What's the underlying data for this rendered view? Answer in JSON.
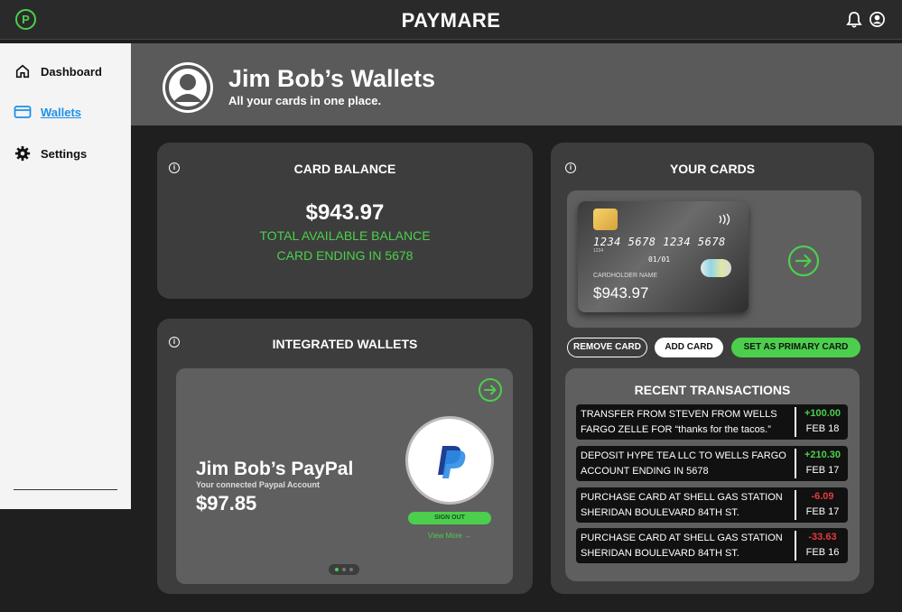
{
  "app": {
    "title": "PAYMARE",
    "logo_letter": "P",
    "accent": "#4ccf4c"
  },
  "sidebar": {
    "items": [
      {
        "label": "Dashboard",
        "icon": "home-icon"
      },
      {
        "label": "Wallets",
        "icon": "card-icon",
        "active": true
      },
      {
        "label": "Settings",
        "icon": "gear-icon"
      }
    ]
  },
  "header": {
    "title": "Jim Bob’s Wallets",
    "subtitle": "All your cards in one place."
  },
  "balance": {
    "title": "CARD BALANCE",
    "amount": "$943.97",
    "line1": "TOTAL AVAILABLE BALANCE",
    "line2": "CARD ENDING IN 5678"
  },
  "wallets": {
    "title": "INTEGRATED WALLETS",
    "name": "Jim Bob’s PayPal",
    "subtitle": "Your connected Paypal Account",
    "amount": "$97.85",
    "signout": "SIGN OUT",
    "view_more": "View More",
    "slides_total": 3,
    "slide_active": 1
  },
  "cards": {
    "title": "YOUR CARDS",
    "card": {
      "number": "1234 5678 1234 5678",
      "small_number": "1234",
      "expiry": "01/01",
      "holder_label": "CARDHOLDER NAME",
      "balance": "$943.97"
    },
    "buttons": {
      "remove": "REMOVE CARD",
      "add": "ADD CARD",
      "primary": "SET AS PRIMARY CARD"
    }
  },
  "transactions": {
    "title": "RECENT TRANSACTIONS",
    "items": [
      {
        "desc": "TRANSFER FROM STEVEN FROM WELLS FARGO ZELLE FOR “thanks for the tacos.”",
        "amount": "+100.00",
        "date": "FEB 18",
        "type": "pos"
      },
      {
        "desc": "DEPOSIT HYPE TEA LLC TO WELLS FARGO ACCOUNT ENDING IN 5678",
        "amount": "+210.30",
        "date": "FEB 17",
        "type": "pos"
      },
      {
        "desc": "PURCHASE CARD AT SHELL GAS STATION SHERIDAN BOULEVARD 84TH ST.",
        "amount": "-6.09",
        "date": "FEB 17",
        "type": "neg"
      },
      {
        "desc": "PURCHASE CARD AT SHELL GAS STATION SHERIDAN BOULEVARD 84TH ST.",
        "amount": "-33.63",
        "date": "FEB 16",
        "type": "neg"
      }
    ]
  }
}
